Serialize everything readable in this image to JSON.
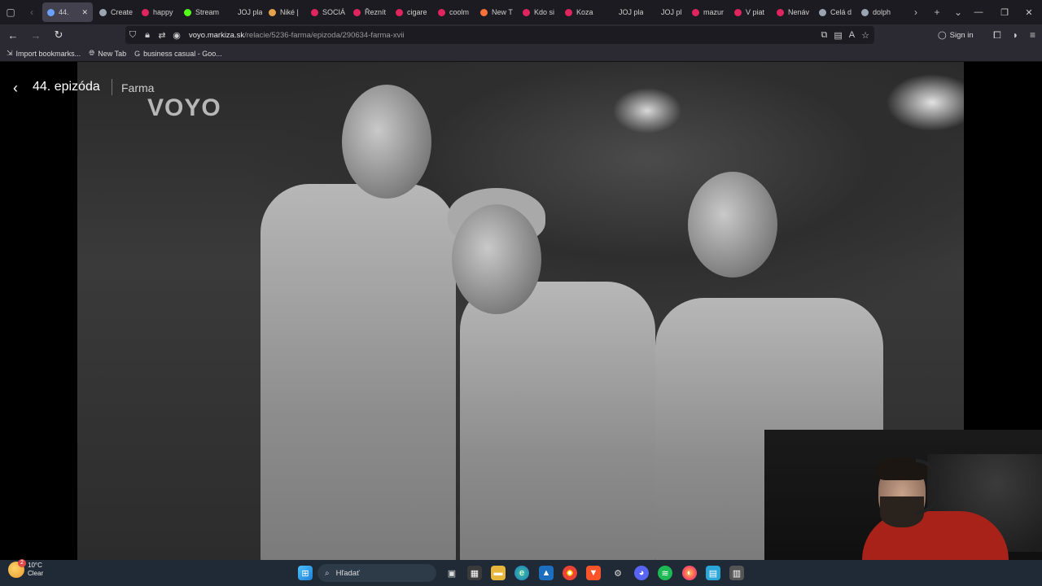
{
  "browser": {
    "tabs": [
      {
        "label": "44.",
        "icon": "voyo-icon",
        "color": "#6aa0ff",
        "active": true
      },
      {
        "label": "Create",
        "icon": "doc-icon",
        "color": "#9aa5b1"
      },
      {
        "label": "happy",
        "icon": "youtube-icon",
        "color": "#e0245e"
      },
      {
        "label": "Stream",
        "icon": "kick-icon",
        "color": "#53fc18"
      },
      {
        "label": "JOJ play",
        "icon": "joj-icon",
        "color": "#1c1b22"
      },
      {
        "label": "Niké |",
        "icon": "niké-icon",
        "color": "#e5a24a"
      },
      {
        "label": "SOCIÁ",
        "icon": "youtube-icon",
        "color": "#e0245e"
      },
      {
        "label": "Řeznít",
        "icon": "youtube-icon",
        "color": "#e0245e"
      },
      {
        "label": "cigare",
        "icon": "youtube-icon",
        "color": "#e0245e"
      },
      {
        "label": "coolm",
        "icon": "youtube-icon",
        "color": "#e0245e"
      },
      {
        "label": "New T",
        "icon": "firefox-icon",
        "color": "#ff7139"
      },
      {
        "label": "Kdo si",
        "icon": "plus-icon",
        "color": "#e0245e"
      },
      {
        "label": "Koza",
        "icon": "youtube-icon",
        "color": "#e0245e"
      },
      {
        "label": "JOJ play",
        "icon": "joj-icon",
        "color": "#1c1b22"
      },
      {
        "label": "JOJ pl",
        "icon": "joj-icon",
        "color": "#1c1b22"
      },
      {
        "label": "mazur",
        "icon": "youtube-icon",
        "color": "#e0245e"
      },
      {
        "label": "V piat",
        "icon": "youtube-icon",
        "color": "#e0245e"
      },
      {
        "label": "Nenáv",
        "icon": "youtube-icon",
        "color": "#e0245e"
      },
      {
        "label": "Celá d",
        "icon": "doc-icon",
        "color": "#9aa5b1"
      },
      {
        "label": "dolph",
        "icon": "google-icon",
        "color": "#9aa5b1"
      }
    ],
    "url_host": "voyo.markiza.sk",
    "url_path": "/relacie/5236-farma/epizoda/290634-farma-xvii",
    "sign_in_label": "Sign in",
    "bookmarks": [
      {
        "label": "Import bookmarks...",
        "icon": "import-icon"
      },
      {
        "label": "New Tab",
        "icon": "globe-icon"
      },
      {
        "label": "business casual - Goo...",
        "icon": "google-icon"
      }
    ]
  },
  "player": {
    "episode_title": "44. epizóda",
    "show_name": "Farma",
    "watermark": "VOYO"
  },
  "taskbar": {
    "weather_temp": "10°C",
    "weather_desc": "Clear",
    "weather_badge": "2",
    "search_placeholder": "Hľadať"
  }
}
